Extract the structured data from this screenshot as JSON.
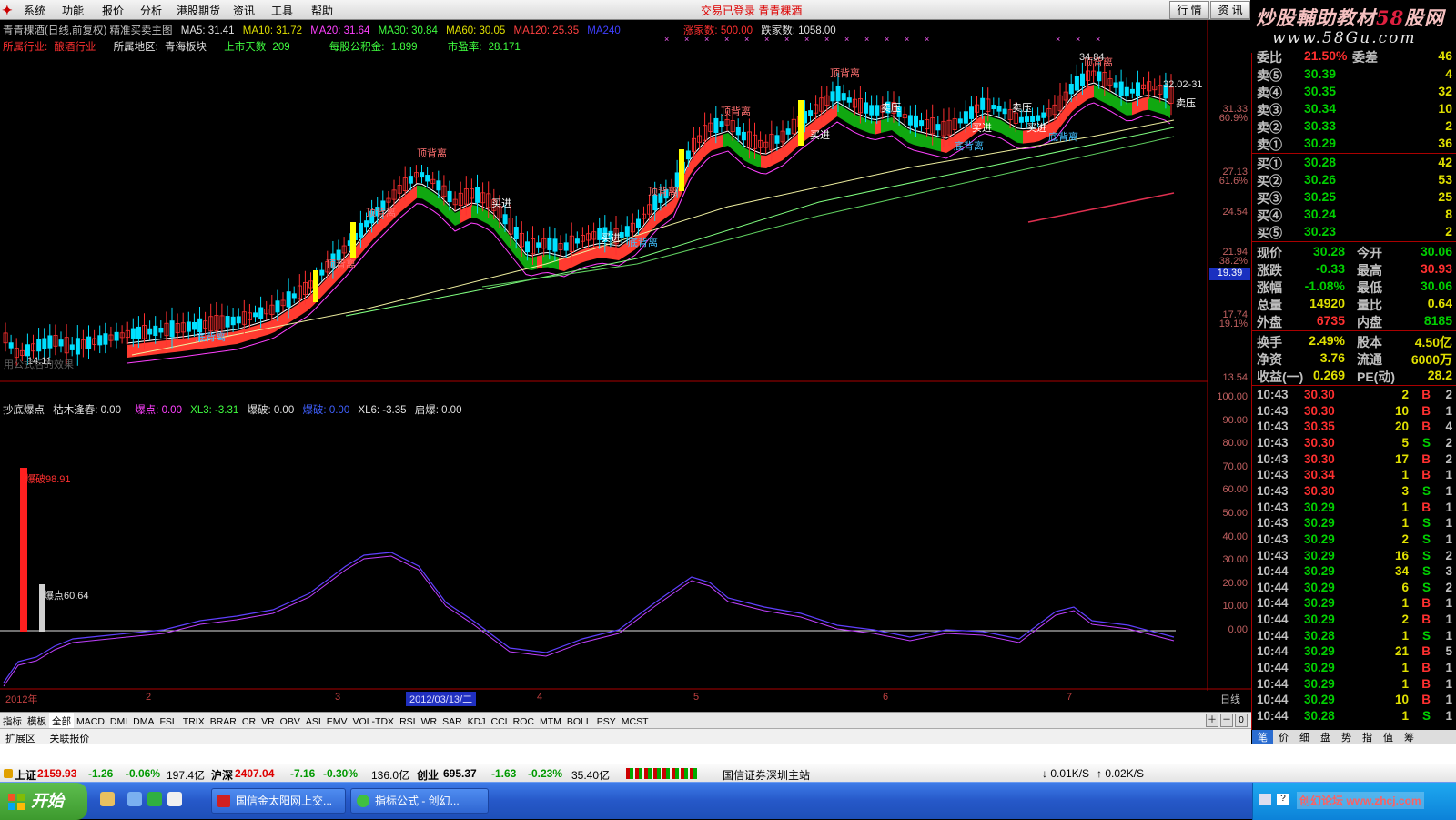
{
  "menu": {
    "items": [
      "系统",
      "功能",
      "报价",
      "分析",
      "港股期货",
      "资讯",
      "工具",
      "帮助"
    ],
    "notice": "交易已登录  青青稞酒",
    "btn_quotes": "行 情",
    "btn_news": "资 讯"
  },
  "brand": {
    "line1_a": "炒股輔助教材",
    "line1_b": "58",
    "line1_c": "股网",
    "line2": "www.58Gu.com"
  },
  "info1": {
    "title": "青青稞酒(日线,前复权) 精准买卖主图",
    "ma5": "MA5: 31.41",
    "ma10": "MA10: 31.72",
    "ma20": "MA20: 31.64",
    "ma30": "MA30: 30.84",
    "ma60": "MA60: 30.05",
    "ma120": "MA120: 25.35",
    "ma240": "MA240",
    "up": "涨家数: 500.00",
    "down": "跌家数: 1058.00"
  },
  "info2": {
    "industry_label": "所属行业:",
    "industry": "酿酒行业",
    "region_label": "所属地区:",
    "region": "青海板块",
    "days_label": "上市天数",
    "days": "209",
    "fund_label": "每股公积金:",
    "fund": "1.899",
    "pe_label": "市盈率:",
    "pe": "28.171"
  },
  "chart_labels": {
    "high": "34.84",
    "low": "14.11",
    "last": "32.02-31",
    "cross": "19.39",
    "tbx": [
      "顶背离",
      "底背离",
      "卖压",
      "买进"
    ],
    "watermark": "用公式后的效果"
  },
  "axis_main": [
    {
      "v": "31.33",
      "p": "60.9%"
    },
    {
      "v": "27.13",
      "p": "61.6%"
    },
    {
      "v": "24.54",
      "p": ""
    },
    {
      "v": "21.94",
      "p": "38.2%"
    },
    {
      "v": "17.74",
      "p": "19.1%"
    },
    {
      "v": "13.54",
      "p": ""
    }
  ],
  "lower": {
    "name": "抄底爆点",
    "k1": "枯木逢春: 0.00",
    "k2": "爆点: 0.00",
    "k3": "XL3: -3.31",
    "k4": "爆破: 0.00",
    "k5": "爆破: 0.00",
    "k6": "XL6: -3.35",
    "k7": "启爆: 0.00",
    "lbl_a": "爆破98.91",
    "lbl_b": "爆点60.64"
  },
  "axis_lower": [
    "100.00",
    "90.00",
    "80.00",
    "70.00",
    "60.00",
    "50.00",
    "40.00",
    "30.00",
    "20.00",
    "10.00",
    "0.00"
  ],
  "dates": {
    "y": "2012年",
    "m2": "2",
    "m3": "3",
    "cur": "2012/03/13/二",
    "m4": "4",
    "m5": "5",
    "m6": "6",
    "m7": "7",
    "period": "日线"
  },
  "tabs": [
    "指标",
    "模板",
    "全部",
    "MACD",
    "DMI",
    "DMA",
    "FSL",
    "TRIX",
    "BRAR",
    "CR",
    "VR",
    "OBV",
    "ASI",
    "EMV",
    "VOL-TDX",
    "RSI",
    "WR",
    "SAR",
    "KDJ",
    "CCI",
    "ROC",
    "MTM",
    "BOLL",
    "PSY",
    "MCST"
  ],
  "ext": [
    "扩展区",
    "关联报价"
  ],
  "orderbook": {
    "header": {
      "l": "委比",
      "p": "21.50%",
      "m": "委差",
      "v": "46"
    },
    "asks": [
      {
        "l": "卖⑤",
        "p": "30.39",
        "v": "4"
      },
      {
        "l": "卖④",
        "p": "30.35",
        "v": "32"
      },
      {
        "l": "卖③",
        "p": "30.34",
        "v": "10"
      },
      {
        "l": "卖②",
        "p": "30.33",
        "v": "2"
      },
      {
        "l": "卖①",
        "p": "30.29",
        "v": "36"
      }
    ],
    "bids": [
      {
        "l": "买①",
        "p": "30.28",
        "v": "42"
      },
      {
        "l": "买②",
        "p": "30.26",
        "v": "53"
      },
      {
        "l": "买③",
        "p": "30.25",
        "v": "25"
      },
      {
        "l": "买④",
        "p": "30.24",
        "v": "8"
      },
      {
        "l": "买⑤",
        "p": "30.23",
        "v": "2"
      }
    ]
  },
  "quote": [
    {
      "a": "现价",
      "b": "30.28",
      "c": "今开",
      "d": "30.06",
      "bc": "#00d000",
      "dc": "#00d000"
    },
    {
      "a": "涨跌",
      "b": "-0.33",
      "c": "最高",
      "d": "30.93",
      "bc": "#00d000",
      "dc": "#ff3030"
    },
    {
      "a": "涨幅",
      "b": "-1.08%",
      "c": "最低",
      "d": "30.06",
      "bc": "#00d000",
      "dc": "#00d000"
    },
    {
      "a": "总量",
      "b": "14920",
      "c": "量比",
      "d": "0.64",
      "bc": "#e0e000",
      "dc": "#e0e000"
    },
    {
      "a": "外盘",
      "b": "6735",
      "c": "内盘",
      "d": "8185",
      "bc": "#ff3030",
      "dc": "#00d000"
    },
    {
      "a": "换手",
      "b": "2.49%",
      "c": "股本",
      "d": "4.50亿",
      "bc": "#e0e000",
      "dc": "#e0e000"
    },
    {
      "a": "净资",
      "b": "3.76",
      "c": "流通",
      "d": "6000万",
      "bc": "#e0e000",
      "dc": "#e0e000"
    },
    {
      "a": "收益(一)",
      "b": "0.269",
      "c": "PE(动)",
      "d": "28.2",
      "bc": "#e0e000",
      "dc": "#e0e000"
    }
  ],
  "ticks": [
    {
      "t": "10:43",
      "p": "30.30",
      "v": "2",
      "s": "B",
      "n": "2"
    },
    {
      "t": "10:43",
      "p": "30.30",
      "v": "10",
      "s": "B",
      "n": "1"
    },
    {
      "t": "10:43",
      "p": "30.35",
      "v": "20",
      "s": "B",
      "n": "4"
    },
    {
      "t": "10:43",
      "p": "30.30",
      "v": "5",
      "s": "S",
      "n": "2"
    },
    {
      "t": "10:43",
      "p": "30.30",
      "v": "17",
      "s": "B",
      "n": "2"
    },
    {
      "t": "10:43",
      "p": "30.34",
      "v": "1",
      "s": "B",
      "n": "1"
    },
    {
      "t": "10:43",
      "p": "30.30",
      "v": "3",
      "s": "S",
      "n": "1"
    },
    {
      "t": "10:43",
      "p": "30.29",
      "v": "1",
      "s": "B",
      "n": "1"
    },
    {
      "t": "10:43",
      "p": "30.29",
      "v": "1",
      "s": "S",
      "n": "1"
    },
    {
      "t": "10:43",
      "p": "30.29",
      "v": "2",
      "s": "S",
      "n": "1"
    },
    {
      "t": "10:43",
      "p": "30.29",
      "v": "16",
      "s": "S",
      "n": "2"
    },
    {
      "t": "10:44",
      "p": "30.29",
      "v": "34",
      "s": "S",
      "n": "3"
    },
    {
      "t": "10:44",
      "p": "30.29",
      "v": "6",
      "s": "S",
      "n": "2"
    },
    {
      "t": "10:44",
      "p": "30.29",
      "v": "1",
      "s": "B",
      "n": "1"
    },
    {
      "t": "10:44",
      "p": "30.29",
      "v": "2",
      "s": "B",
      "n": "1"
    },
    {
      "t": "10:44",
      "p": "30.28",
      "v": "1",
      "s": "S",
      "n": "1"
    },
    {
      "t": "10:44",
      "p": "30.29",
      "v": "21",
      "s": "B",
      "n": "5"
    },
    {
      "t": "10:44",
      "p": "30.29",
      "v": "1",
      "s": "B",
      "n": "1"
    },
    {
      "t": "10:44",
      "p": "30.29",
      "v": "1",
      "s": "B",
      "n": "1"
    },
    {
      "t": "10:44",
      "p": "30.29",
      "v": "10",
      "s": "B",
      "n": "1"
    },
    {
      "t": "10:44",
      "p": "30.28",
      "v": "1",
      "s": "S",
      "n": "1"
    }
  ],
  "rtabs": [
    "笔",
    "价",
    "细",
    "盘",
    "势",
    "指",
    "值",
    "筹"
  ],
  "index": {
    "sh": "上证",
    "sh_v": "2159.93",
    "sh_c": "-1.26",
    "sh_p": "-0.06%",
    "sh_a": "197.4亿",
    "sz": "沪深",
    "sz_v": "2407.04",
    "sz_c": "-7.16",
    "sz_p": "-0.30%",
    "sz_a": "136.0亿",
    "cy": "创业",
    "cy_v": "695.37",
    "cy_c": "-1.63",
    "cy_p": "-0.23%",
    "cy_a": "35.40亿",
    "site": "国信证券深圳主站",
    "dn": "0.01K/S",
    "up": "0.02K/S"
  },
  "taskbar": {
    "start": "开始",
    "task1": "国信金太阳网上交...",
    "task2": "指标公式 - 创幻...",
    "tray": "创幻论坛 www.zhcj.com"
  },
  "colors": {
    "up": "#ff3030",
    "down": "#00d0ff",
    "green": "#00c000",
    "yellow": "#ffff00"
  }
}
